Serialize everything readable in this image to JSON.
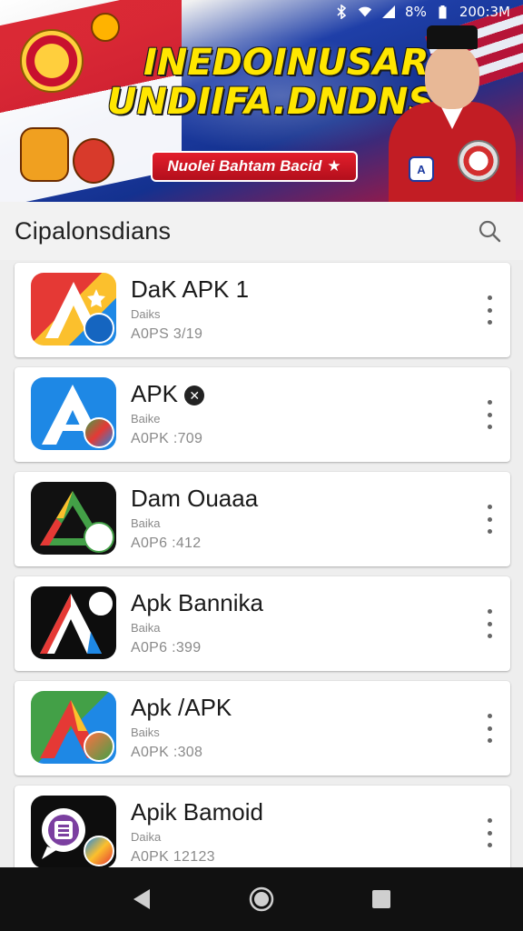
{
  "status_bar": {
    "battery_text": "8%",
    "time": "200:3M",
    "icons": [
      "bluetooth-icon",
      "wifi-icon",
      "signal-icon"
    ]
  },
  "banner": {
    "headline_line1": "INEDOINUSAR",
    "headline_line2": "UNDIIFA.DNDNSIA",
    "cta_label": "Nuolei Bahtam Bacid",
    "badge_letter": "A",
    "colors": {
      "red": "#c8102e",
      "blue": "#1f3fa8",
      "yellow": "#ffe600"
    }
  },
  "section": {
    "title": "Cipalonsdians",
    "search_icon": "search-icon"
  },
  "apps": [
    {
      "name": "DaK APK 1",
      "sub": "Daiks",
      "meta": "A0PS 3/19"
    },
    {
      "name": "APK",
      "sub": "Baike",
      "meta": "A0PK :709"
    },
    {
      "name": "Dam Ouaaa",
      "sub": "Baika",
      "meta": "A0P6 :412"
    },
    {
      "name": "Apk Bannika",
      "sub": "Baika",
      "meta": "A0P6 :399"
    },
    {
      "name": "Apk /APK",
      "sub": "Baiks",
      "meta": "A0PK :308"
    },
    {
      "name": "Apik Bamoid",
      "sub": "Daika",
      "meta": "A0PK 12123"
    }
  ],
  "nav": {
    "back": "back-icon",
    "home": "home-icon",
    "recents": "recents-icon"
  }
}
